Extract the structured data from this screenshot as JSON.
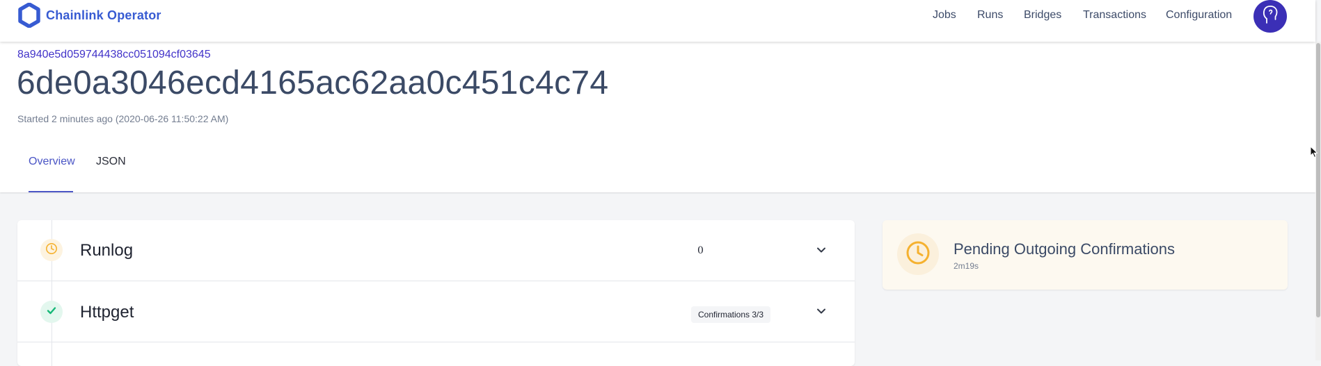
{
  "app": {
    "name": "Chainlink Operator",
    "logo_icon": "chainlink-hexagon-icon",
    "brand_color": "#375bd2"
  },
  "nav": {
    "items": [
      {
        "label": "Jobs"
      },
      {
        "label": "Runs"
      },
      {
        "label": "Bridges"
      },
      {
        "label": "Transactions"
      },
      {
        "label": "Configuration"
      }
    ],
    "avatar_icon": "user-avatar-icon"
  },
  "run": {
    "job_id": "8a940e5d059744438cc051094cf03645",
    "run_id": "6de0a3046ecd4165ac62aa0c451c4c74",
    "started": "Started 2 minutes ago (2020-06-26 11:50:22 AM)"
  },
  "tabs": [
    {
      "label": "Overview",
      "active": true
    },
    {
      "label": "JSON",
      "active": false
    }
  ],
  "tasks": [
    {
      "name": "Runlog",
      "status": "pending",
      "status_icon": "clock-icon",
      "value": "0",
      "expand_icon": "chevron-down-icon"
    },
    {
      "name": "Httpget",
      "status": "completed",
      "status_icon": "check-icon",
      "badge": "Confirmations 3/3",
      "expand_icon": "chevron-down-icon"
    }
  ],
  "status_panel": {
    "title": "Pending Outgoing Confirmations",
    "elapsed": "2m19s",
    "icon": "clock-icon",
    "accent_color": "#f5b12f"
  },
  "colors": {
    "accent": "#4a55c5",
    "pending": "#f5b12f",
    "success": "#16b877"
  }
}
